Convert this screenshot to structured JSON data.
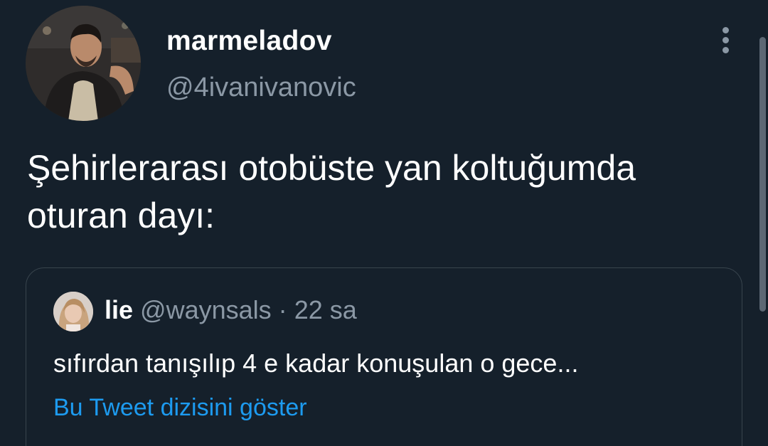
{
  "author": {
    "display_name": "marmeladov",
    "handle": "@4ivanivanovic"
  },
  "tweet": {
    "text": "Şehirlerarası otobüste yan koltuğumda oturan dayı:"
  },
  "quoted_tweet": {
    "display_name": "lie",
    "handle": "@waynsals",
    "separator": "·",
    "time": "22 sa",
    "text": "sıfırdan tanışılıp 4 e kadar konuşulan o gece...",
    "show_thread_label": "Bu Tweet dizisini göster"
  },
  "icons": {
    "more": "more-vertical-icon"
  },
  "colors": {
    "background": "#15202b",
    "primary_text": "#ffffff",
    "secondary_text": "#8b98a5",
    "link": "#1d9bf0",
    "border": "#38444d"
  }
}
